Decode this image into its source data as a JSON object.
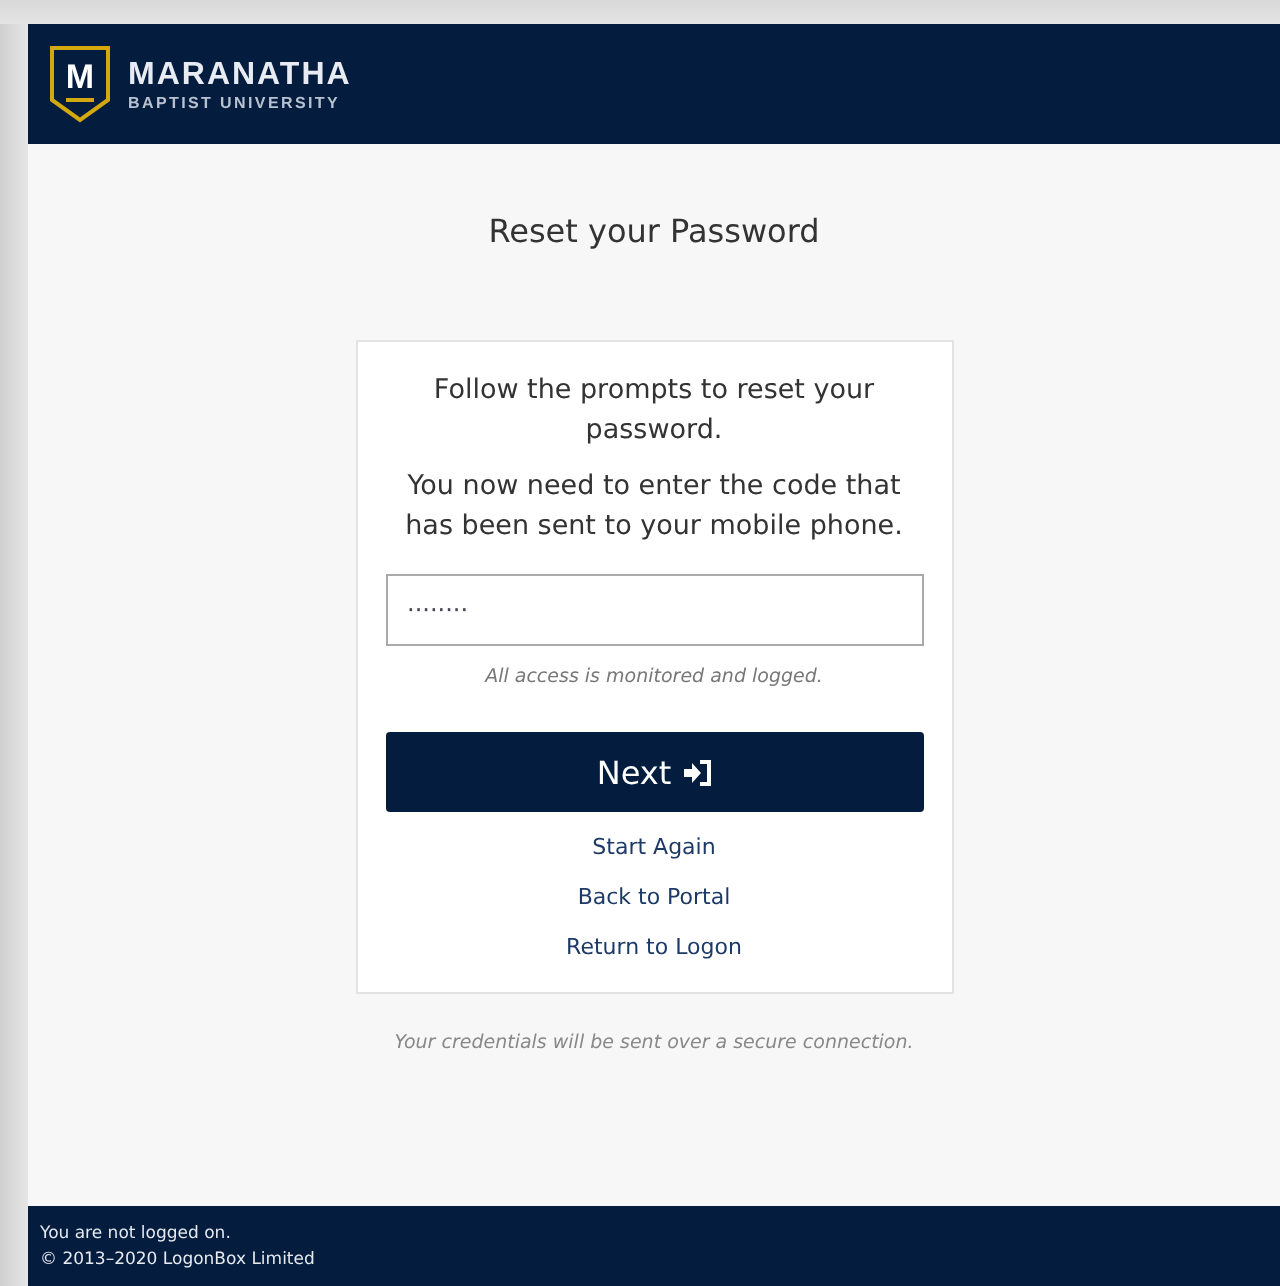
{
  "header": {
    "logo_letter": "M",
    "brand": "MARANATHA",
    "subtitle": "BAPTIST UNIVERSITY"
  },
  "title": "Reset your Password",
  "card": {
    "prompts": [
      "Follow the prompts to reset your password.",
      "You now need to enter the code that has been sent to your mobile phone."
    ],
    "code_field": {
      "value": "········"
    },
    "notice": "All access is monitored and logged.",
    "next_button": "Next",
    "links": [
      "Start Again",
      "Back to Portal",
      "Return to Logon"
    ]
  },
  "secure_note": "Your credentials will be sent over a secure connection.",
  "footer": [
    "You are not logged on.",
    "© 2013–2020 LogonBox Limited"
  ]
}
